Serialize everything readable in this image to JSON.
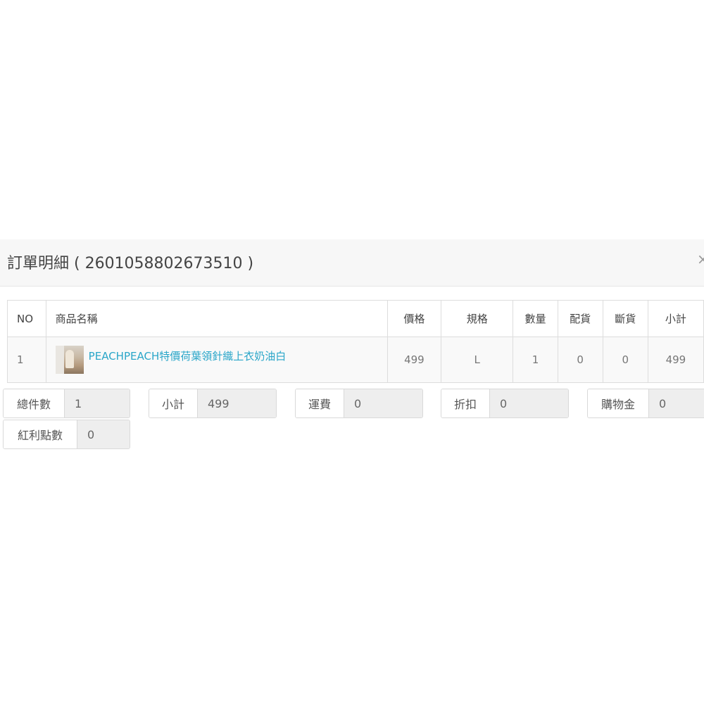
{
  "modal": {
    "title": "訂單明細 ( 2601058802673510 )",
    "close_label": "×"
  },
  "table": {
    "headers": {
      "no": "NO",
      "name": "商品名稱",
      "price": "價格",
      "spec": "規格",
      "qty": "數量",
      "alloc": "配貨",
      "out": "斷貨",
      "subtotal": "小計"
    },
    "rows": [
      {
        "no": "1",
        "name": "PEACHPEACH特價荷葉領針織上衣奶油白",
        "price": "499",
        "spec": "L",
        "qty": "1",
        "alloc": "0",
        "out": "0",
        "subtotal": "499"
      }
    ]
  },
  "summary": {
    "total_items": {
      "label": "總件數",
      "value": "1"
    },
    "subtotal": {
      "label": "小計",
      "value": "499"
    },
    "shipping": {
      "label": "運費",
      "value": "0"
    },
    "discount": {
      "label": "折扣",
      "value": "0"
    },
    "credit": {
      "label": "購物金",
      "value": "0"
    },
    "bonus_points": {
      "label": "紅利點數",
      "value": "0"
    }
  }
}
